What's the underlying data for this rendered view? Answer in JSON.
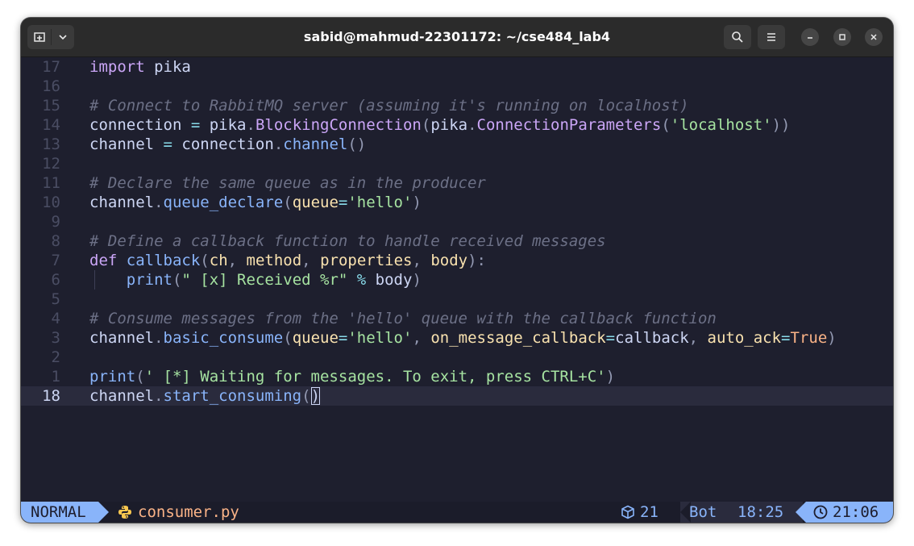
{
  "window": {
    "title": "sabid@mahmud-22301172: ~/cse484_lab4"
  },
  "editor": {
    "lines": [
      {
        "num": "17",
        "tokens": [
          [
            "kw",
            "import"
          ],
          [
            "id",
            " pika"
          ]
        ]
      },
      {
        "num": "16",
        "tokens": []
      },
      {
        "num": "15",
        "tokens": [
          [
            "cm",
            "# Connect to RabbitMQ server (assuming it's running on localhost)"
          ]
        ]
      },
      {
        "num": "14",
        "tokens": [
          [
            "id",
            "connection "
          ],
          [
            "op",
            "="
          ],
          [
            "id",
            " pika"
          ],
          [
            "punc",
            "."
          ],
          [
            "cls",
            "BlockingConnection"
          ],
          [
            "punc",
            "("
          ],
          [
            "id",
            "pika"
          ],
          [
            "punc",
            "."
          ],
          [
            "cls",
            "ConnectionParameters"
          ],
          [
            "punc",
            "("
          ],
          [
            "str",
            "'localhost'"
          ],
          [
            "punc",
            "))"
          ]
        ]
      },
      {
        "num": "13",
        "tokens": [
          [
            "id",
            "channel "
          ],
          [
            "op",
            "="
          ],
          [
            "id",
            " connection"
          ],
          [
            "punc",
            "."
          ],
          [
            "fn",
            "channel"
          ],
          [
            "punc",
            "()"
          ]
        ]
      },
      {
        "num": "12",
        "tokens": []
      },
      {
        "num": "11",
        "tokens": [
          [
            "cm",
            "# Declare the same queue as in the producer"
          ]
        ]
      },
      {
        "num": "10",
        "tokens": [
          [
            "id",
            "channel"
          ],
          [
            "punc",
            "."
          ],
          [
            "fn",
            "queue_declare"
          ],
          [
            "punc",
            "("
          ],
          [
            "par",
            "queue"
          ],
          [
            "op",
            "="
          ],
          [
            "str",
            "'hello'"
          ],
          [
            "punc",
            ")"
          ]
        ]
      },
      {
        "num": "9",
        "tokens": []
      },
      {
        "num": "8",
        "tokens": [
          [
            "cm",
            "# Define a callback function to handle received messages"
          ]
        ]
      },
      {
        "num": "7",
        "tokens": [
          [
            "kw",
            "def"
          ],
          [
            "id",
            " "
          ],
          [
            "fn",
            "callback"
          ],
          [
            "punc",
            "("
          ],
          [
            "par",
            "ch"
          ],
          [
            "punc",
            ", "
          ],
          [
            "par",
            "method"
          ],
          [
            "punc",
            ", "
          ],
          [
            "par",
            "properties"
          ],
          [
            "punc",
            ", "
          ],
          [
            "par",
            "body"
          ],
          [
            "punc",
            "):"
          ]
        ]
      },
      {
        "num": "6",
        "indent": true,
        "tokens": [
          [
            "id",
            "    "
          ],
          [
            "fn",
            "print"
          ],
          [
            "punc",
            "("
          ],
          [
            "str",
            "\" [x] Received %r\""
          ],
          [
            "id",
            " "
          ],
          [
            "op",
            "%"
          ],
          [
            "id",
            " body"
          ],
          [
            "punc",
            ")"
          ]
        ]
      },
      {
        "num": "5",
        "tokens": []
      },
      {
        "num": "4",
        "tokens": [
          [
            "cm",
            "# Consume messages from the 'hello' queue with the callback function"
          ]
        ]
      },
      {
        "num": "3",
        "tokens": [
          [
            "id",
            "channel"
          ],
          [
            "punc",
            "."
          ],
          [
            "fn",
            "basic_consume"
          ],
          [
            "punc",
            "("
          ],
          [
            "par",
            "queue"
          ],
          [
            "op",
            "="
          ],
          [
            "str",
            "'hello'"
          ],
          [
            "punc",
            ", "
          ],
          [
            "par",
            "on_message_callback"
          ],
          [
            "op",
            "="
          ],
          [
            "id",
            "callback"
          ],
          [
            "punc",
            ", "
          ],
          [
            "par",
            "auto_ack"
          ],
          [
            "op",
            "="
          ],
          [
            "bool",
            "True"
          ],
          [
            "punc",
            ")"
          ]
        ]
      },
      {
        "num": "2",
        "tokens": []
      },
      {
        "num": "1",
        "tokens": [
          [
            "fn",
            "print"
          ],
          [
            "punc",
            "("
          ],
          [
            "str",
            "' [*] Waiting for messages. To exit, press CTRL+C'"
          ],
          [
            "punc",
            ")"
          ]
        ]
      },
      {
        "num": "18",
        "current": true,
        "tokens": [
          [
            "id",
            "channel"
          ],
          [
            "punc",
            "."
          ],
          [
            "fn",
            "start_consuming"
          ],
          [
            "punc",
            "("
          ],
          [
            "cursor",
            ")"
          ]
        ]
      }
    ]
  },
  "statusline": {
    "mode": "NORMAL",
    "filename": "consumer.py",
    "file_icon": "python-icon",
    "package_icon": "cube-icon",
    "package_count": "21",
    "scroll": "Bot",
    "cursor_position": "18:25",
    "clock_icon": "clock-icon",
    "time": "21:06"
  },
  "colors": {
    "background": "#1e1f2e",
    "accent": "#89b4fa",
    "keyword": "#cba6f7",
    "string": "#a6e3a1",
    "parameter": "#f9e2af",
    "comment": "#6c7086",
    "filename": "#fab387"
  }
}
